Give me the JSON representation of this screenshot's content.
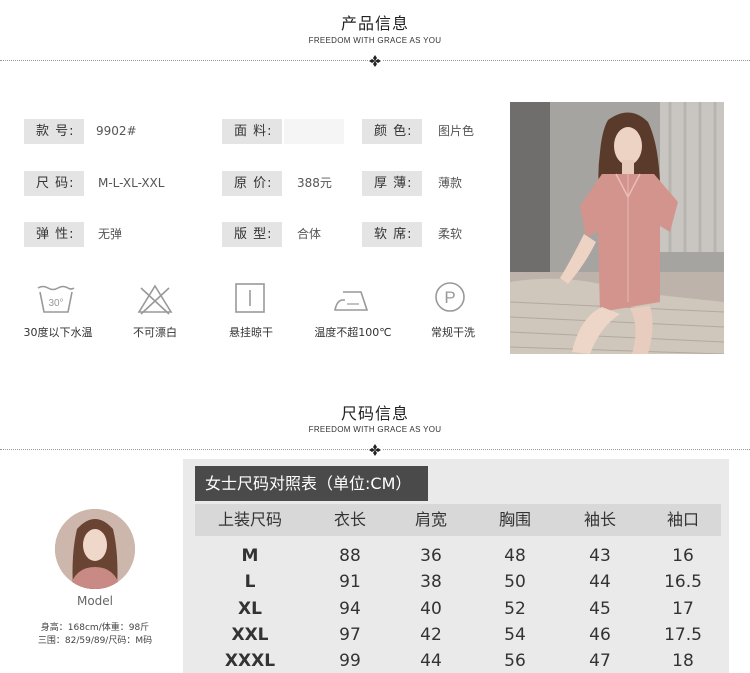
{
  "product_section": {
    "title": "产品信息",
    "subtitle": "FREEDOM WITH GRACE AS YOU"
  },
  "specs": [
    {
      "label": "款 号:",
      "value": "9902#"
    },
    {
      "label": "面 料:",
      "value": ""
    },
    {
      "label": "颜 色:",
      "value": "图片色"
    },
    {
      "label": "尺 码:",
      "value": "M-L-XL-XXL"
    },
    {
      "label": "原 价:",
      "value": "388元"
    },
    {
      "label": "厚 薄:",
      "value": "薄款"
    },
    {
      "label": "弹 性:",
      "value": "无弹"
    },
    {
      "label": "版 型:",
      "value": "合体"
    },
    {
      "label": "软 席:",
      "value": "柔软"
    }
  ],
  "care": [
    {
      "icon": "wash-30-icon",
      "label": "30度以下水温",
      "icon_text": "30°"
    },
    {
      "icon": "no-bleach-icon",
      "label": "不可漂白"
    },
    {
      "icon": "hang-dry-icon",
      "label": "悬挂晾干"
    },
    {
      "icon": "iron-icon",
      "label": "温度不超100℃"
    },
    {
      "icon": "dry-clean-icon",
      "label": "常规干洗",
      "icon_text": "P"
    }
  ],
  "size_section": {
    "title": "尺码信息",
    "subtitle": "FREEDOM WITH GRACE AS YOU"
  },
  "model": {
    "label": "Model",
    "line1": "身高：168cm/体重：98斤",
    "line2": "三围：82/59/89/尺码：M码"
  },
  "size_table": {
    "title": "女士尺码对照表（单位:CM）",
    "headers": [
      "上装尺码",
      "衣长",
      "肩宽",
      "胸围",
      "袖长",
      "袖口"
    ],
    "rows": [
      [
        "M",
        "88",
        "36",
        "48",
        "43",
        "16"
      ],
      [
        "L",
        "91",
        "38",
        "50",
        "44",
        "16.5"
      ],
      [
        "XL",
        "94",
        "40",
        "52",
        "45",
        "17"
      ],
      [
        "XXL",
        "97",
        "42",
        "54",
        "46",
        "17.5"
      ],
      [
        "XXXL",
        "99",
        "44",
        "56",
        "47",
        "18"
      ]
    ]
  },
  "colors": {
    "pajama_pink": "#d4948e",
    "table_title_bg": "#4a4a4a",
    "table_bg": "#eaeaea",
    "label_bg": "#e4e4e4"
  }
}
